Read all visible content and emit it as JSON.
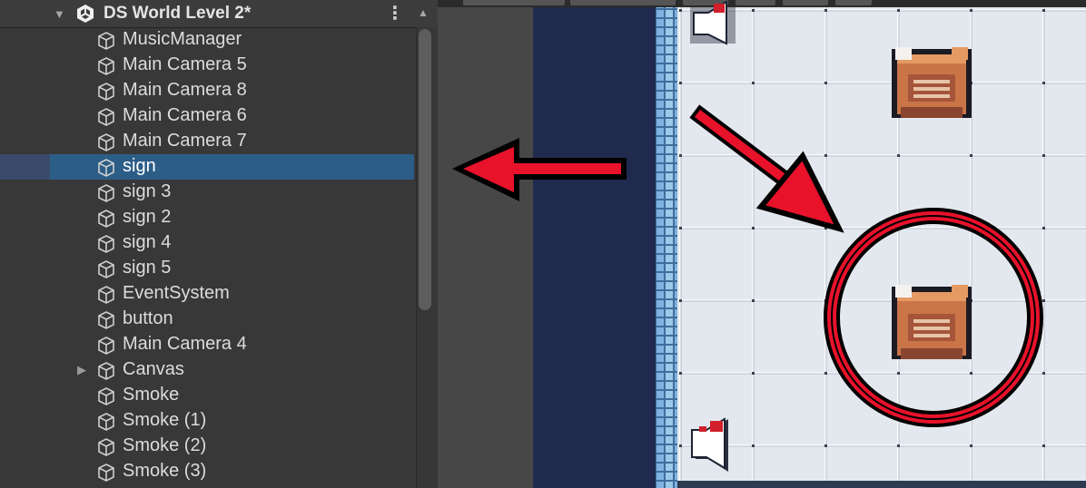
{
  "hierarchy": {
    "scene_title": "DS World Level 2*",
    "fold_glyph": "▼",
    "menu_glyph": "⋮",
    "scroll_up_glyph": "▲",
    "scroll_position": 0.0,
    "items": [
      {
        "label": "MusicManager",
        "selected": false,
        "expandable": false
      },
      {
        "label": "Main Camera 5",
        "selected": false,
        "expandable": false
      },
      {
        "label": "Main Camera 8",
        "selected": false,
        "expandable": false
      },
      {
        "label": "Main Camera 6",
        "selected": false,
        "expandable": false
      },
      {
        "label": "Main Camera 7",
        "selected": false,
        "expandable": false
      },
      {
        "label": "sign",
        "selected": true,
        "expandable": false
      },
      {
        "label": "sign 3",
        "selected": false,
        "expandable": false
      },
      {
        "label": "sign 2",
        "selected": false,
        "expandable": false
      },
      {
        "label": "sign 4",
        "selected": false,
        "expandable": false
      },
      {
        "label": "sign 5",
        "selected": false,
        "expandable": false
      },
      {
        "label": "EventSystem",
        "selected": false,
        "expandable": false
      },
      {
        "label": "button",
        "selected": false,
        "expandable": false
      },
      {
        "label": "Main Camera 4",
        "selected": false,
        "expandable": false
      },
      {
        "label": "Canvas",
        "selected": false,
        "expandable": true
      },
      {
        "label": "Smoke",
        "selected": false,
        "expandable": false
      },
      {
        "label": "Smoke (1)",
        "selected": false,
        "expandable": false
      },
      {
        "label": "Smoke (2)",
        "selected": false,
        "expandable": false
      },
      {
        "label": "Smoke (3)",
        "selected": false,
        "expandable": false
      }
    ],
    "expand_glyph": "▶",
    "icons": {
      "scene": "unity-logo-icon",
      "object": "gameobject-cube-icon",
      "menu": "kebab-menu-icon"
    }
  },
  "scene_view": {
    "objects": [
      "sign-sprite",
      "sign-sprite",
      "speaker-icon",
      "speaker-icon"
    ],
    "annotations": [
      "arrow-left",
      "arrow-diagonal",
      "circle-highlight"
    ]
  },
  "colors": {
    "panel_bg": "#383838",
    "selected_row": "#2c5d87",
    "annotation_red": "#e8122a",
    "scene_dark_blue": "#1f2a4e",
    "tile_bg": "#e3e8ef",
    "tile_border": "#9aa4b3",
    "wall_blue": "#5a8dc0"
  }
}
